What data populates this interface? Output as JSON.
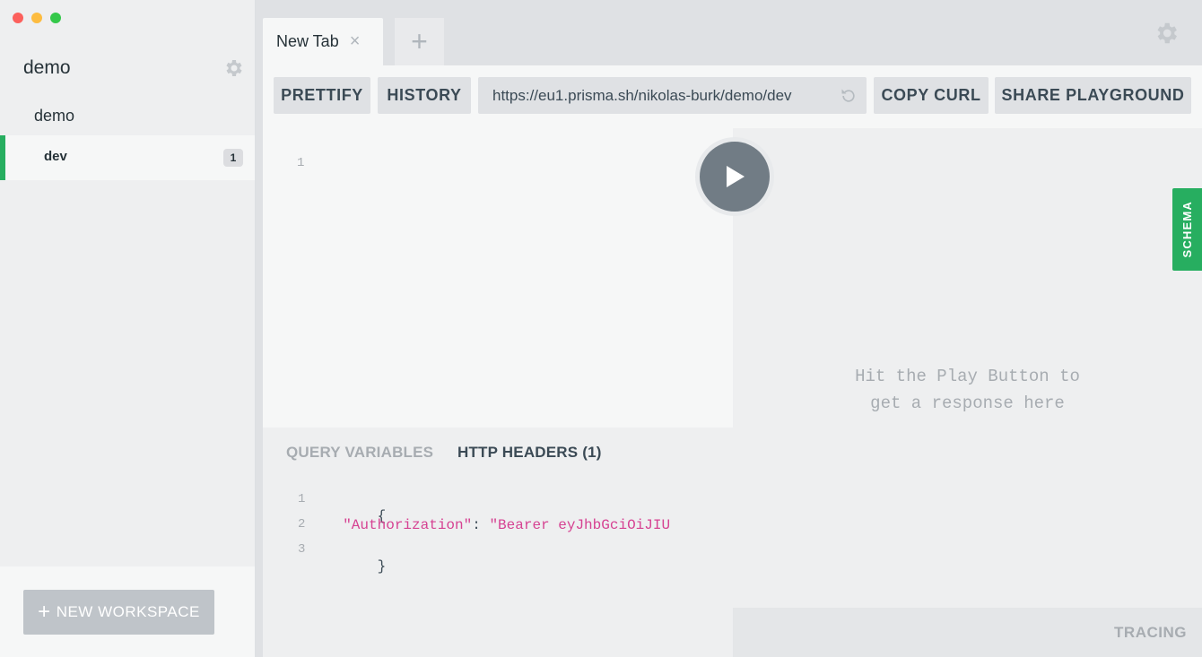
{
  "sidebar": {
    "workspace_title": "demo",
    "project_title": "demo",
    "stage": {
      "label": "dev",
      "count": "1"
    },
    "new_workspace_label": "NEW WORKSPACE"
  },
  "tabs": [
    {
      "label": "New Tab"
    }
  ],
  "toolbar": {
    "prettify_label": "PRETTIFY",
    "history_label": "HISTORY",
    "endpoint_url": "https://eu1.prisma.sh/nikolas-burk/demo/dev",
    "copy_curl_label": "COPY CURL",
    "share_label": "SHARE PLAYGROUND"
  },
  "editor": {
    "line_numbers": [
      "1"
    ]
  },
  "result": {
    "hint": "Hit the Play Button to\nget a response here",
    "schema_label": "SCHEMA",
    "tracing_label": "TRACING"
  },
  "variables": {
    "tab_query_variables": "QUERY VARIABLES",
    "tab_http_headers": "HTTP HEADERS (1)",
    "line_numbers": [
      "1",
      "2",
      "3"
    ],
    "open_brace": "{",
    "header_key": "\"Authorization\"",
    "colon": ": ",
    "header_value": "\"Bearer eyJhbGciOiJIU",
    "close_brace": "}"
  },
  "colors": {
    "accent_green": "#27ae60",
    "string_pink": "#d64292"
  }
}
